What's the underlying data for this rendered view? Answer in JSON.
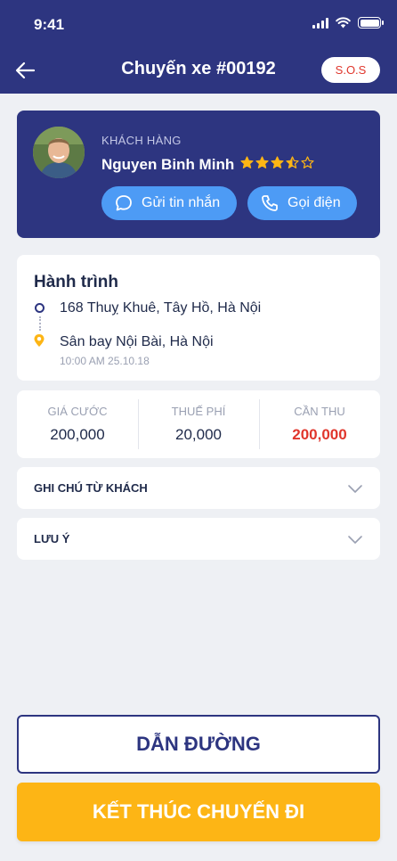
{
  "status_bar": {
    "time": "9:41"
  },
  "header": {
    "title": "Chuyến xe #00192",
    "sos_label": "S.O.S"
  },
  "customer": {
    "label": "KHÁCH HÀNG",
    "name": "Nguyen Binh Minh",
    "rating": 3.5,
    "rating_max": 5,
    "message_label": "Gửi tin nhắn",
    "call_label": "Gọi điện"
  },
  "trip": {
    "title": "Hành trình",
    "from": "168 Thuỵ Khuê, Tây Hồ, Hà Nội",
    "to": "Sân bay Nội Bài, Hà Nội",
    "time": "10:00 AM 25.10.18"
  },
  "fees": [
    {
      "label": "GIÁ CƯỚC",
      "value": "200,000"
    },
    {
      "label": "THUẾ PHÍ",
      "value": "20,000"
    },
    {
      "label": "CẦN THU",
      "value": "200,000"
    }
  ],
  "sections": {
    "note_label": "GHI CHÚ TỪ KHÁCH",
    "warning_label": "LƯU Ý"
  },
  "actions": {
    "navigate_label": "DẪN ĐƯỜNG",
    "finish_label": "KẾT THÚC CHUYẾN ĐI"
  },
  "colors": {
    "primary": "#2d3580",
    "accent_blue": "#4d9bf5",
    "star": "#fdb515",
    "total_red": "#e0362c",
    "finish": "#fdb515"
  }
}
